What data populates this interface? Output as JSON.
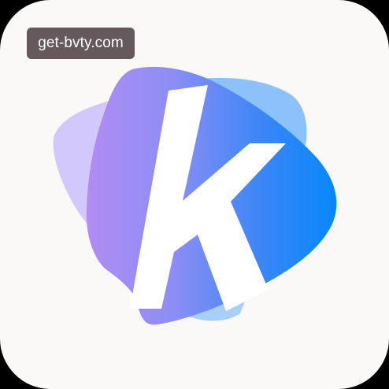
{
  "badge": {
    "url_text": "get-bvty.com"
  },
  "logo": {
    "icon": "k-logo-icon",
    "letter": "k"
  },
  "colors": {
    "tile_background": "#fbf8f8",
    "badge_background": "#66595e",
    "badge_text": "#ffffff",
    "gradient_start": "#a98af5",
    "gradient_end": "#0a87fb",
    "back_shape_left": "#d3c8fb",
    "back_shape_right": "#8cc1fb",
    "letter": "#ffffff"
  }
}
